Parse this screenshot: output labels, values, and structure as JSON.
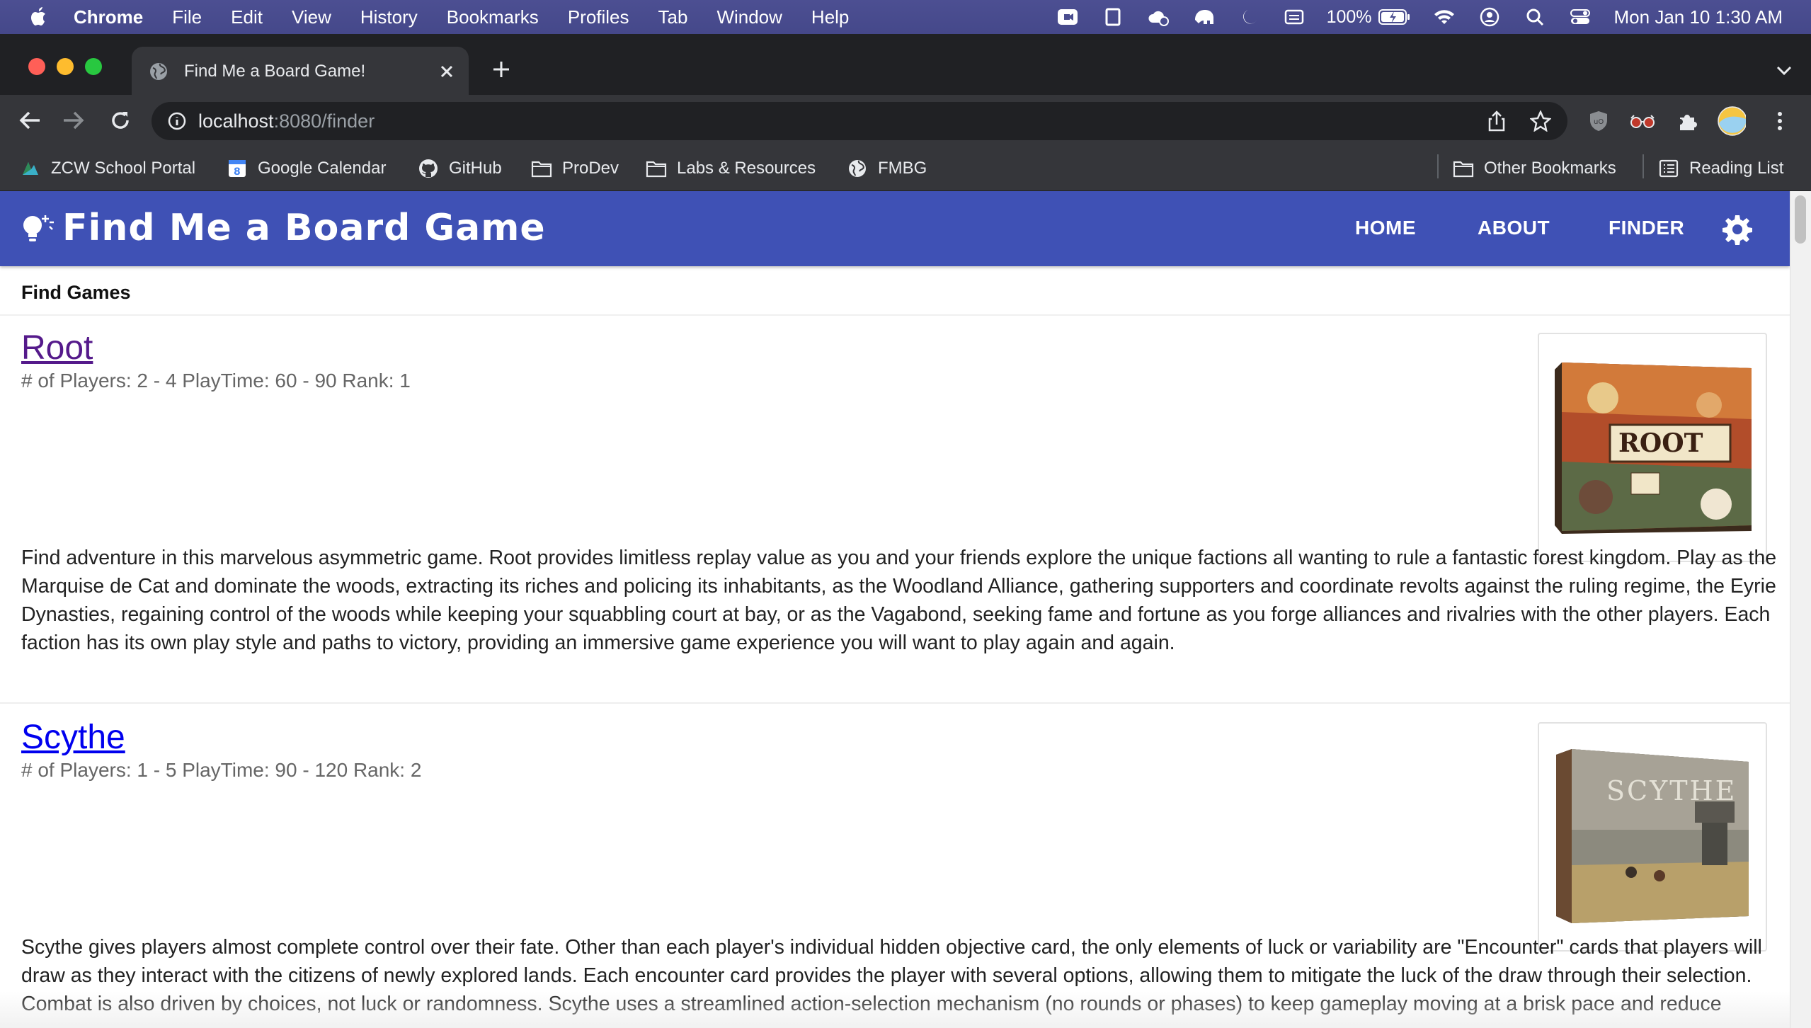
{
  "menubar": {
    "app": "Chrome",
    "items": [
      "File",
      "Edit",
      "View",
      "History",
      "Bookmarks",
      "Profiles",
      "Tab",
      "Window",
      "Help"
    ],
    "battery": "100%",
    "clock": "Mon Jan 10  1:30 AM"
  },
  "browser": {
    "tab_title": "Find Me a Board Game!",
    "url_host": "localhost",
    "url_rest": ":8080/finder",
    "bookmarks": [
      {
        "label": "ZCW School Portal",
        "icon": "zcw-icon"
      },
      {
        "label": "Google Calendar",
        "icon": "calendar-icon"
      },
      {
        "label": "GitHub",
        "icon": "github-icon"
      },
      {
        "label": "ProDev",
        "icon": "folder-icon"
      },
      {
        "label": "Labs & Resources",
        "icon": "folder-icon"
      },
      {
        "label": "FMBG",
        "icon": "globe-icon"
      }
    ],
    "other_bookmarks": "Other Bookmarks",
    "reading_list": "Reading List"
  },
  "app": {
    "brand": "Find Me a Board Game",
    "nav": {
      "home": "HOME",
      "about": "ABOUT",
      "finder": "FINDER"
    },
    "section_title": "Find Games",
    "colors": {
      "appbar": "#3f51b5",
      "visited_link": "#551a8b",
      "link": "#0000ee"
    }
  },
  "games": [
    {
      "title": "Root",
      "meta": "# of Players: 2 - 4 PlayTime: 60 - 90 Rank: 1",
      "box_art_text": "ROOT",
      "description": "Find adventure in this marvelous asymmetric game. Root provides limitless replay value as you and your friends explore the unique factions all wanting to rule a fantastic forest kingdom. Play as the Marquise de Cat and dominate the woods, extracting its riches and policing its inhabitants, as the Woodland Alliance, gathering supporters and coordinate revolts against the ruling regime, the Eyrie Dynasties, regaining control of the woods while keeping your squabbling court at bay, or as the Vagabond, seeking fame and fortune as you forge alliances and rivalries with the other players. Each faction has its own play style and paths to victory, providing an immersive game experience you will want to play again and again."
    },
    {
      "title": "Scythe",
      "meta": "# of Players: 1 - 5 PlayTime: 90 - 120 Rank: 2",
      "box_art_text": "SCYTHE",
      "description": "Scythe gives players almost complete control over their fate. Other than each player's individual hidden objective card, the only elements of luck or variability are \"Encounter\" cards that players will draw as they interact with the citizens of newly explored lands. Each encounter card provides the player with several options, allowing them to mitigate the luck of the draw through their selection. Combat is also driven by choices, not luck or randomness. Scythe uses a streamlined action-selection mechanism (no rounds or phases) to keep gameplay moving at a brisk pace and reduce"
    }
  ]
}
